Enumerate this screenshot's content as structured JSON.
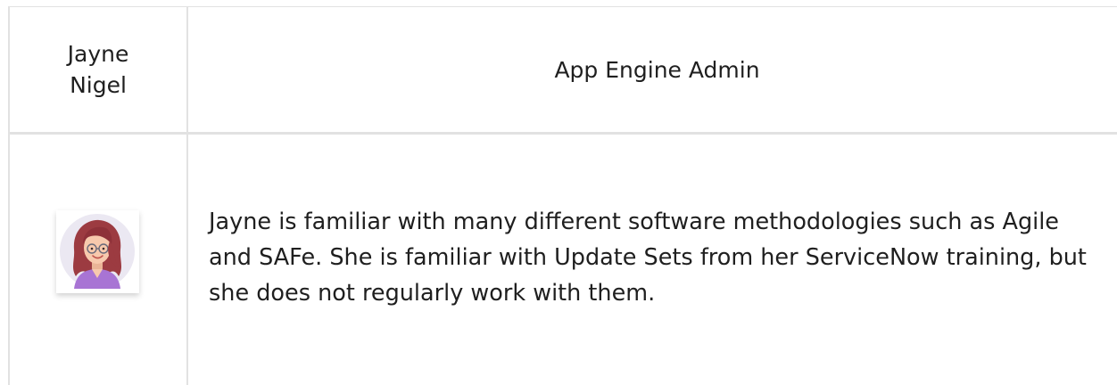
{
  "persona": {
    "name": "Jayne\nNigel",
    "name_line1": "Jayne",
    "name_line2": "Nigel",
    "role": "App Engine Admin",
    "bio": "Jayne is familiar with many different software methodologies such as Agile and SAFe. She is familiar with Update Sets from her ServiceNow training, but she does not regularly work with them.",
    "avatar_icon": "woman-avatar-icon"
  },
  "colors": {
    "border": "#e2e2e2",
    "text": "#1f1f1f",
    "avatar_bg": "#ebe8f2",
    "hair": "#9c3b41",
    "skin": "#f7c9ad",
    "shirt": "#a874d4"
  }
}
